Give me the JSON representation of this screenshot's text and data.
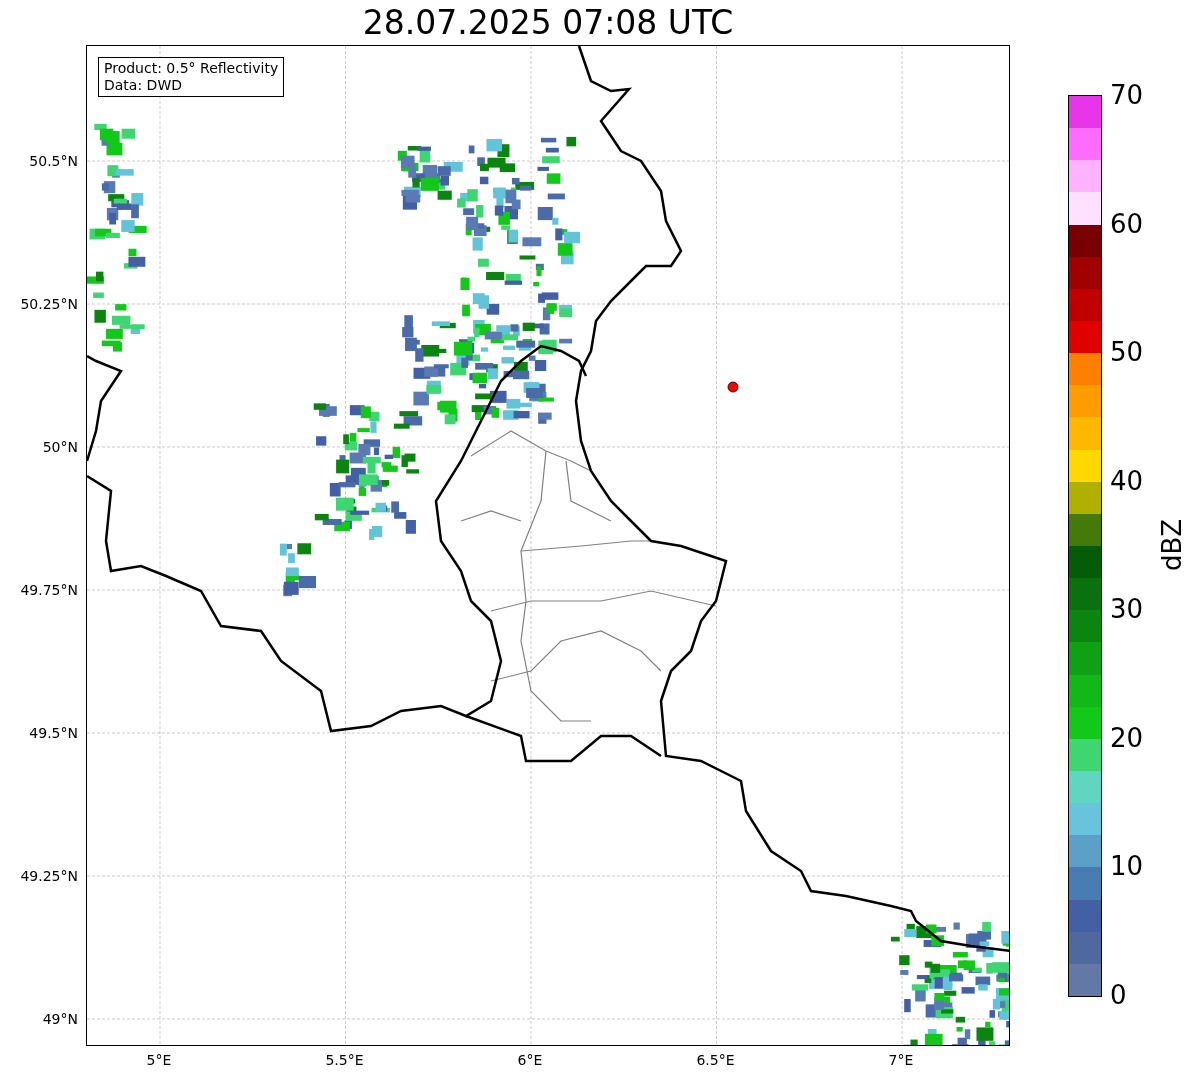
{
  "title": "28.07.2025 07:08 UTC",
  "legend": [
    "Product: 0.5° Reflectivity",
    "Data: DWD"
  ],
  "map": {
    "x_ticks": [
      "5°E",
      "5.5°E",
      "6°E",
      "6.5°E",
      "7°E"
    ],
    "y_ticks": [
      "50.5°N",
      "50.25°N",
      "50°N",
      "49.75°N",
      "49.5°N",
      "49.25°N",
      "49°N"
    ]
  },
  "colorbar": {
    "label": "dBZ",
    "ticks": [
      "70",
      "60",
      "50",
      "40",
      "30",
      "20",
      "10",
      "0"
    ],
    "bands": [
      {
        "color": "#e935e9"
      },
      {
        "color": "#ff6bff"
      },
      {
        "color": "#ffb3ff"
      },
      {
        "color": "#ffe0ff"
      },
      {
        "color": "#780000"
      },
      {
        "color": "#a00000"
      },
      {
        "color": "#c00000"
      },
      {
        "color": "#e00000"
      },
      {
        "color": "#ff8000"
      },
      {
        "color": "#ff9c00"
      },
      {
        "color": "#ffb800"
      },
      {
        "color": "#ffd800"
      },
      {
        "color": "#b0b000"
      },
      {
        "color": "#457a0a"
      },
      {
        "color": "#065c06"
      },
      {
        "color": "#0a7010"
      },
      {
        "color": "#0b8410"
      },
      {
        "color": "#0fa014"
      },
      {
        "color": "#11b818"
      },
      {
        "color": "#12c818"
      },
      {
        "color": "#3dd670"
      },
      {
        "color": "#60d6c0"
      },
      {
        "color": "#68c4dc"
      },
      {
        "color": "#5ca0c8"
      },
      {
        "color": "#4a7cb4"
      },
      {
        "color": "#4460a4"
      },
      {
        "color": "#5068a0"
      },
      {
        "color": "#6478a8"
      }
    ]
  }
}
